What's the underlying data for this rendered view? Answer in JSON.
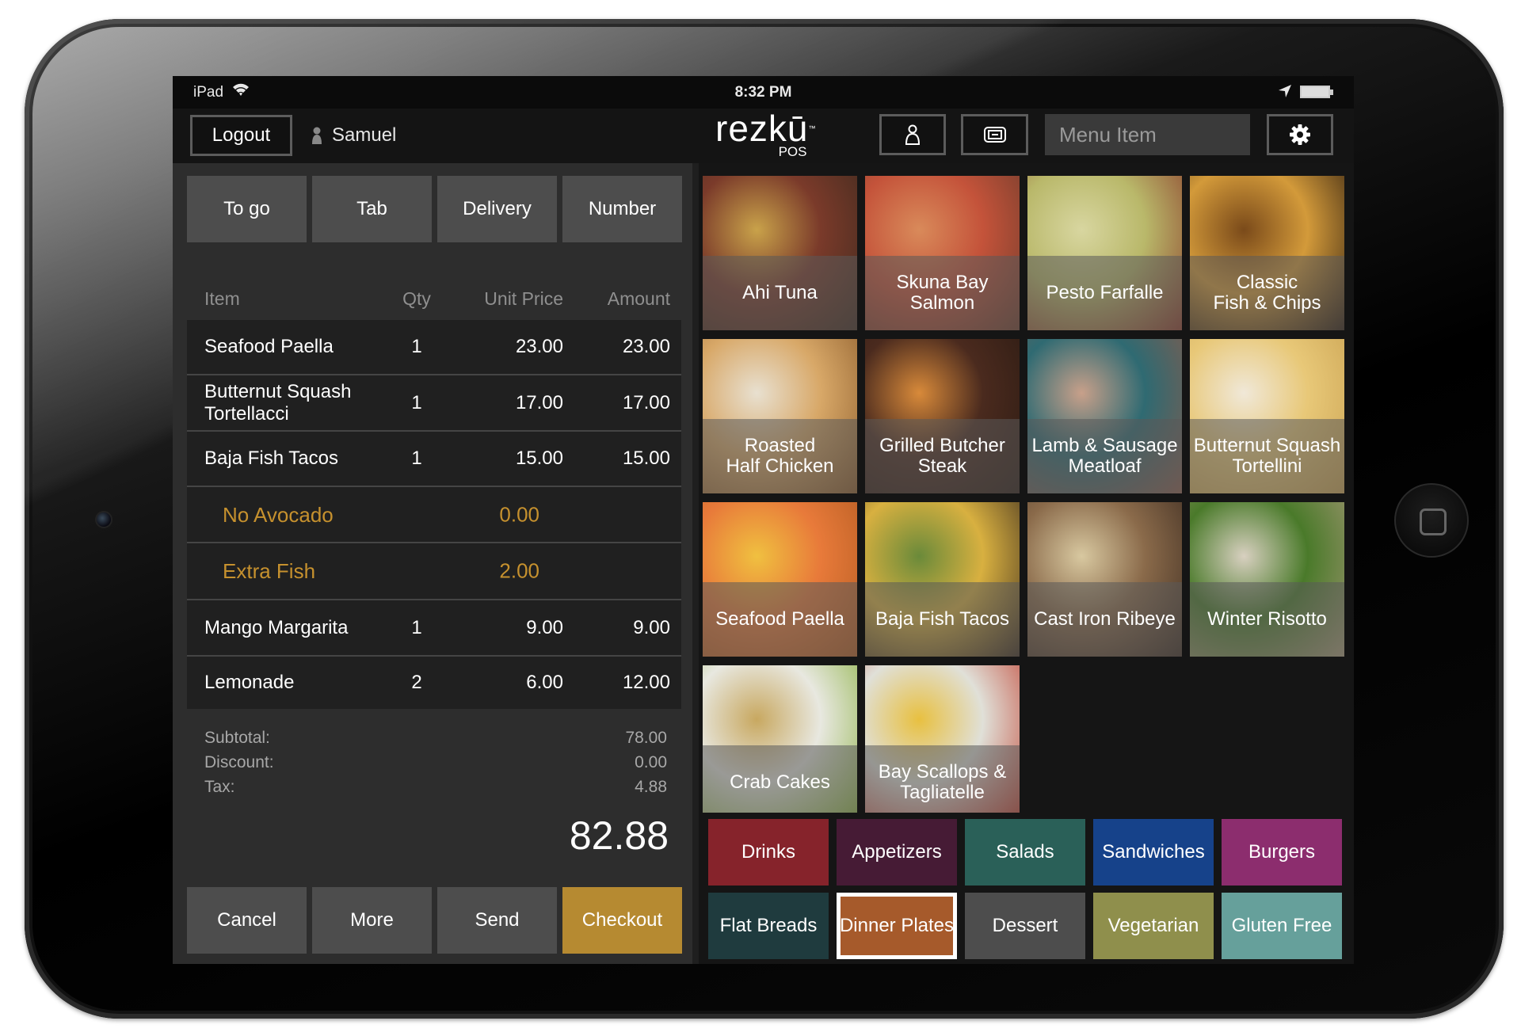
{
  "status_bar": {
    "carrier": "iPad",
    "time": "8:32 PM"
  },
  "header": {
    "logout_label": "Logout",
    "user_name": "Samuel",
    "logo_name": "rezkū",
    "logo_tm": "™",
    "logo_sub": "POS",
    "search_placeholder": "Menu Item",
    "icons": {
      "user": "user-icon",
      "register": "register-icon",
      "search": "search-icon",
      "settings": "gear-icon"
    }
  },
  "order": {
    "types": [
      "To go",
      "Tab",
      "Delivery",
      "Number"
    ],
    "columns": {
      "item": "Item",
      "qty": "Qty",
      "unit_price": "Unit Price",
      "amount": "Amount"
    },
    "rows": [
      {
        "item": "Seafood Paella",
        "qty": "1",
        "unit_price": "23.00",
        "amount": "23.00",
        "modifier": false
      },
      {
        "item": "Butternut Squash\nTortellacci",
        "qty": "1",
        "unit_price": "17.00",
        "amount": "17.00",
        "modifier": false
      },
      {
        "item": "Baja Fish Tacos",
        "qty": "1",
        "unit_price": "15.00",
        "amount": "15.00",
        "modifier": false
      },
      {
        "item": "No Avocado",
        "qty": "",
        "unit_price": "0.00",
        "amount": "",
        "modifier": true
      },
      {
        "item": "Extra Fish",
        "qty": "",
        "unit_price": "2.00",
        "amount": "",
        "modifier": true
      },
      {
        "item": "Mango Margarita",
        "qty": "1",
        "unit_price": "9.00",
        "amount": "9.00",
        "modifier": false
      },
      {
        "item": "Lemonade",
        "qty": "2",
        "unit_price": "6.00",
        "amount": "12.00",
        "modifier": false
      }
    ],
    "totals": [
      {
        "label": "Subtotal:",
        "value": "78.00"
      },
      {
        "label": "Discount:",
        "value": "0.00"
      },
      {
        "label": "Tax:",
        "value": "4.88"
      }
    ],
    "grand_total": "82.88",
    "actions": [
      "Cancel",
      "More",
      "Send",
      "Checkout"
    ],
    "modifier_color": "#c6912e",
    "checkout_color": "#b68a31"
  },
  "menu": {
    "items": [
      {
        "name": "Ahi Tuna",
        "colors": [
          "#7a3a2a",
          "#c9a24a",
          "#3d2a1e"
        ]
      },
      {
        "name": "Skuna Bay\nSalmon",
        "colors": [
          "#c4533a",
          "#d98a5a",
          "#6b3b2b"
        ]
      },
      {
        "name": "Pesto Farfalle",
        "colors": [
          "#b9b86a",
          "#d8d6a0",
          "#8a3a2a"
        ]
      },
      {
        "name": "Classic\nFish & Chips",
        "colors": [
          "#d39a3a",
          "#7a4a1a",
          "#2a1a0e"
        ]
      },
      {
        "name": "Roasted\nHalf Chicken",
        "colors": [
          "#d8a868",
          "#e8e0d0",
          "#8a5a2a"
        ]
      },
      {
        "name": "Grilled Butcher\nSteak",
        "colors": [
          "#4a2a1e",
          "#d88a3a",
          "#2a1a12"
        ]
      },
      {
        "name": "Lamb & Sausage\nMeatloaf",
        "colors": [
          "#2f6a72",
          "#c8a08a",
          "#8a5a4a"
        ]
      },
      {
        "name": "Butternut Squash\nTortellini",
        "colors": [
          "#e8c878",
          "#f0e8d8",
          "#c8a050"
        ]
      },
      {
        "name": "Seafood Paella",
        "colors": [
          "#e87a3a",
          "#f0c040",
          "#b05a20"
        ]
      },
      {
        "name": "Baja Fish Tacos",
        "colors": [
          "#d8b040",
          "#6a8a3a",
          "#3a2a1e"
        ]
      },
      {
        "name": "Cast Iron Ribeye",
        "colors": [
          "#8a6a4a",
          "#d8c8a0",
          "#3a2a20"
        ]
      },
      {
        "name": "Winter Risotto",
        "colors": [
          "#4a7a2a",
          "#d8d0c0",
          "#a89878"
        ]
      },
      {
        "name": "Crab Cakes",
        "colors": [
          "#e8e8e0",
          "#c8a860",
          "#8ab040"
        ]
      },
      {
        "name": "Bay Scallops &\nTagliatelle",
        "colors": [
          "#e0e0d8",
          "#e8c040",
          "#c04030"
        ]
      }
    ]
  },
  "categories": [
    {
      "label": "Drinks",
      "color": "#86232b",
      "selected": false
    },
    {
      "label": "Appetizers",
      "color": "#461b35",
      "selected": false
    },
    {
      "label": "Salads",
      "color": "#2a6058",
      "selected": false
    },
    {
      "label": "Sandwiches",
      "color": "#16428a",
      "selected": false
    },
    {
      "label": "Burgers",
      "color": "#8c2d6e",
      "selected": false
    },
    {
      "label": "Flat Breads",
      "color": "#1f3b3e",
      "selected": false
    },
    {
      "label": "Dinner Plates",
      "color": "#a65a2b",
      "selected": true
    },
    {
      "label": "Dessert",
      "color": "#4d4d4d",
      "selected": false
    },
    {
      "label": "Vegetarian",
      "color": "#8f8f4c",
      "selected": false
    },
    {
      "label": "Gluten Free",
      "color": "#66a09b",
      "selected": false
    }
  ]
}
